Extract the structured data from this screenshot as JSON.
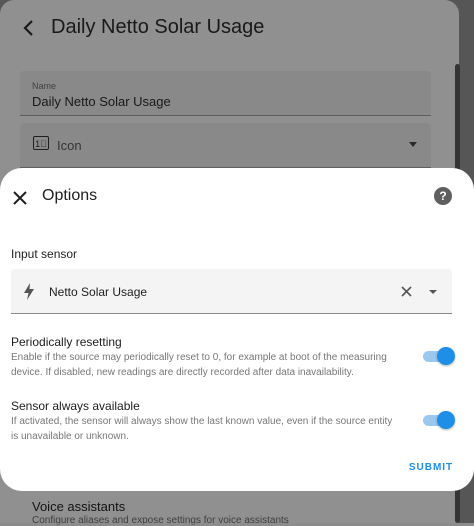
{
  "background_dialog": {
    "title": "Daily Netto Solar Usage",
    "name_field": {
      "label": "Name",
      "value": "Daily Netto Solar Usage"
    },
    "icon_field": {
      "label": "Icon",
      "icon": "icon-placeholder-icon"
    },
    "voice_assistants": {
      "title": "Voice assistants",
      "subtitle": "Configure aliases and expose settings for voice assistants"
    }
  },
  "options": {
    "title": "Options",
    "input_sensor": {
      "label": "Input sensor",
      "value": "Netto Solar Usage",
      "icon": "flash-icon"
    },
    "periodically_resetting": {
      "title": "Periodically resetting",
      "description": "Enable if the source may periodically reset to 0, for example at boot of the measuring device. If disabled, new readings are directly recorded after data inavailability.",
      "enabled": true
    },
    "sensor_always_available": {
      "title": "Sensor always available",
      "description": "If activated, the sensor will always show the last known value, even if the source entity is unavailable or unknown.",
      "enabled": true
    },
    "submit_label": "SUBMIT"
  },
  "colors": {
    "accent": "#1f8ee6",
    "toggle_track": "#9bc8ee"
  }
}
